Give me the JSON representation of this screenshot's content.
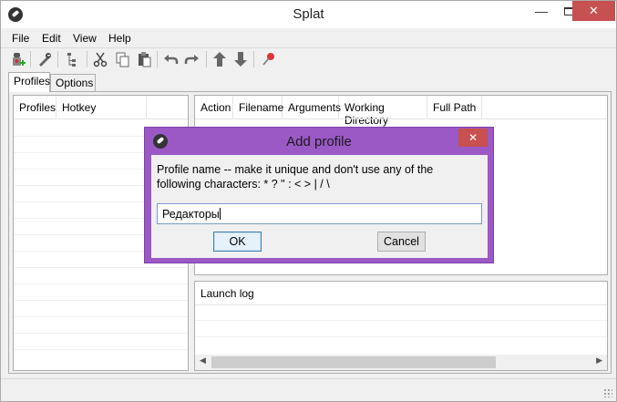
{
  "window": {
    "title": "Splat",
    "minimize": "—",
    "close": "✕"
  },
  "menu": [
    "File",
    "Edit",
    "View",
    "Help"
  ],
  "toolbar": {
    "buttons": [
      "add-profile-icon",
      "edit-profile-icon",
      "properties-icon",
      "cut-icon",
      "copy-icon",
      "paste-icon",
      "undo-icon",
      "redo-icon",
      "move-up-icon",
      "move-down-icon",
      "pin-icon"
    ]
  },
  "tabs": [
    {
      "label": "Profiles",
      "active": true
    },
    {
      "label": "Options",
      "active": false
    }
  ],
  "profiles_list": {
    "columns": [
      "Profiles",
      "Hotkey"
    ]
  },
  "actions_list": {
    "columns": [
      "Action",
      "Filename",
      "Arguments",
      "Working Directory",
      "Full Path"
    ]
  },
  "launch_log": {
    "columns": [
      "Launch log"
    ]
  },
  "dialog": {
    "title": "Add profile",
    "close": "✕",
    "message": "Profile name -- make it unique and don't use any of the\nfollowing characters:    * ? \" : < > | / \\",
    "input_value": "Редакторы",
    "ok_label": "OK",
    "cancel_label": "Cancel"
  },
  "colors": {
    "dialog_frame": "#9b59c6",
    "close_button": "#c75050"
  }
}
